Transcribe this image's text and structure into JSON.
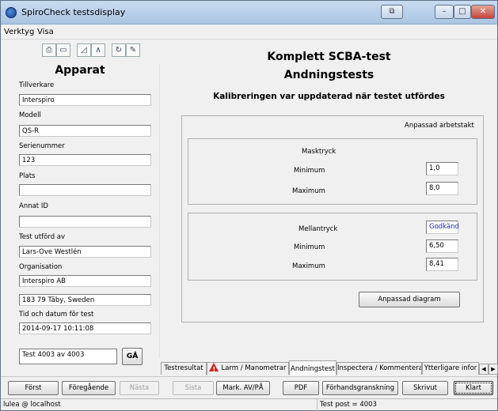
{
  "window": {
    "title": "SpiroCheck testsdisplay"
  },
  "menu": [
    "Verktyg",
    "Visa"
  ],
  "toolbar_icons": [
    "print-icon",
    "print-preview-icon",
    "chart-icon",
    "curve-icon",
    "refresh-icon",
    "sign-icon"
  ],
  "left": {
    "title": "Apparat",
    "fields": [
      {
        "label": "Tillverkare",
        "value": "Interspiro"
      },
      {
        "label": "Modell",
        "value": "QS-R"
      },
      {
        "label": "Serienummer",
        "value": "123"
      },
      {
        "label": "Plats",
        "value": ""
      },
      {
        "label": "Annat ID",
        "value": ""
      },
      {
        "label": "Test utförd av",
        "value": "Lars-Ove Westlén"
      },
      {
        "label": "Organisation",
        "value": "Interspiro AB"
      },
      {
        "label": "",
        "value": "183 79 Täby, Sweden"
      },
      {
        "label": "Tid och datum för test",
        "value": "2014-09-17 10:11:08"
      }
    ],
    "test_nav": {
      "value": "Test 4003 av 4003",
      "go_label": "GÅ"
    }
  },
  "main": {
    "title": "Komplett SCBA-test",
    "section": "Andningstests",
    "calibration_note": "Kalibreringen var uppdaterad när testet utfördes",
    "work_rate_label": "Anpassad arbetstakt",
    "mask_pressure": {
      "label": "Masktryck",
      "min_label": "Minimum",
      "min_value": "1,0",
      "max_label": "Maximum",
      "max_value": "8,0"
    },
    "intermediate_pressure": {
      "label": "Mellantryck",
      "status": "Godkänd",
      "min_label": "Minimum",
      "min_value": "6,50",
      "max_label": "Maximum",
      "max_value": "8,41"
    },
    "custom_diagram_label": "Anpassad diagram"
  },
  "tabs": [
    "Testresultat",
    "Larm / Manometrar",
    "Andningstest",
    "Inspectera / Kommentera",
    "Ytterligare infor"
  ],
  "bottom_buttons": [
    "Först",
    "Föregående",
    "Nästa",
    "Sista",
    "Mark. AV/PÅ",
    "PDF",
    "Förhandsgranskning",
    "Skrivut",
    "Klart"
  ],
  "status": {
    "user": "lulea @ localhost",
    "test_post": "Test post = 4003"
  }
}
